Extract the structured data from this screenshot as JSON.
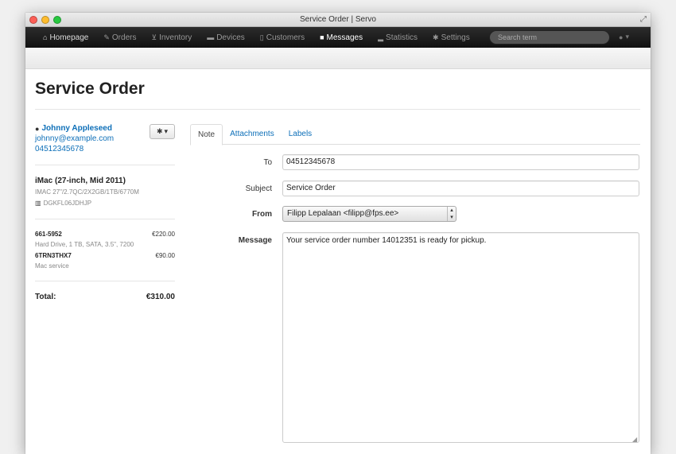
{
  "window": {
    "title": "Service Order | Servo"
  },
  "nav": {
    "items": [
      {
        "icon": "home-icon",
        "glyph": "⌂",
        "label": "Homepage"
      },
      {
        "icon": "wrench-icon",
        "glyph": "✎",
        "label": "Orders"
      },
      {
        "icon": "cart-icon",
        "glyph": "⊻",
        "label": "Inventory"
      },
      {
        "icon": "device-icon",
        "glyph": "▬",
        "label": "Devices"
      },
      {
        "icon": "book-icon",
        "glyph": "▯",
        "label": "Customers"
      },
      {
        "icon": "comment-icon",
        "glyph": "■",
        "label": "Messages"
      },
      {
        "icon": "signal-icon",
        "glyph": "▂",
        "label": "Statistics"
      },
      {
        "icon": "gear-icon",
        "glyph": "✱",
        "label": "Settings"
      }
    ],
    "active": "Messages",
    "search_placeholder": "Search term"
  },
  "page": {
    "title": "Service Order"
  },
  "customer": {
    "name": "Johnny Appleseed",
    "email": "johnny@example.com",
    "phone": "04512345678"
  },
  "device": {
    "name": "iMac (27-inch, Mid 2011)",
    "spec": "IMAC 27\"/2.7QC/2X2GB/1TB/6770M",
    "serial": "DGKFL06JDHJP"
  },
  "parts": [
    {
      "code": "661-5952",
      "price": "€220.00",
      "description": "Hard Drive, 1 TB, SATA, 3.5\", 7200"
    },
    {
      "code": "6TRN3THX7",
      "price": "€90.00",
      "description": "Mac service"
    }
  ],
  "totals": {
    "label": "Total:",
    "value": "€310.00"
  },
  "tabs": [
    "Note",
    "Attachments",
    "Labels"
  ],
  "active_tab": "Note",
  "form": {
    "to_label": "To",
    "to_value": "04512345678",
    "subject_label": "Subject",
    "subject_value": "Service Order",
    "from_label": "From",
    "from_value": "Filipp Lepalaan <filipp@fps.ee>",
    "message_label": "Message",
    "message_value": "Your service order number 14012351 is ready for pickup."
  }
}
